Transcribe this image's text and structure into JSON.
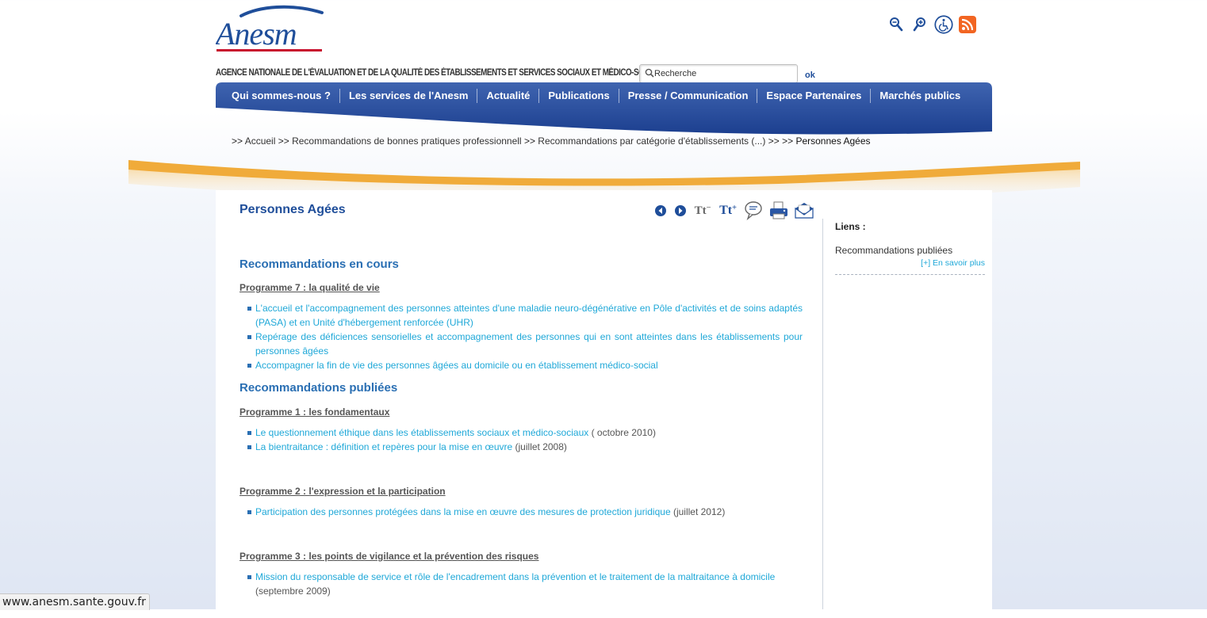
{
  "header": {
    "logo_text": "Anesm",
    "agency_name": "AGENCE NATIONALE DE L'ÉVALUATION ET DE LA QUALITÉ DES ÉTABLISSEMENTS ET SERVICES SOCIAUX ET MÉDICO-SOCIAUX",
    "search": {
      "value": "Recherche",
      "button": "ok"
    },
    "tools": [
      "zoom-out-icon",
      "zoom-in-icon",
      "accessibility-icon",
      "rss-icon"
    ]
  },
  "nav": {
    "items": [
      "Qui sommes-nous ?",
      "Les services de l'Anesm",
      "Actualité",
      "Publications",
      "Presse / Communication",
      "Espace Partenaires",
      "Marchés publics"
    ]
  },
  "breadcrumb": {
    "sep": ">>",
    "items": [
      "Accueil",
      "Recommandations de bonnes pratiques professionnell",
      "Recommandations par catégorie d'établissements (...)",
      ">>",
      "Personnes Agées"
    ]
  },
  "page": {
    "title": "Personnes Agées",
    "tools": [
      "previous-icon",
      "next-icon",
      "decrease-text-icon",
      "increase-text-icon",
      "comment-icon",
      "print-icon",
      "email-icon"
    ],
    "decrease_label": "Tt",
    "increase_label": "Tt",
    "sections": [
      {
        "title": "Recommandations en cours",
        "programmes": [
          {
            "title": "Programme 7 : la qualité de vie",
            "items": [
              {
                "link": "L'accueil et l'accompagnement des personnes atteintes d'une maladie neuro-dégénérative en Pôle d'activités et de soins adaptés (PASA) et en Unité d'hébergement renforcée (UHR)",
                "date": ""
              },
              {
                "link": "Repérage des déficiences sensorielles et accompagnement des personnes qui en sont atteintes dans les établissements pour personnes âgées",
                "date": ""
              },
              {
                "link": "Accompagner la fin de vie des personnes âgées au domicile ou en établissement médico-social",
                "date": ""
              }
            ]
          }
        ]
      },
      {
        "title": "Recommandations publiées",
        "programmes": [
          {
            "title": "Programme 1 : les fondamentaux",
            "items": [
              {
                "link": "Le questionnement éthique dans les établissements sociaux et médico-sociaux",
                "date": " ( octobre 2010)"
              },
              {
                "link": "La bientraitance : définition et repères pour la mise en œuvre",
                "date": " (juillet 2008)"
              }
            ]
          },
          {
            "title": "Programme 2 : l'expression et la participation",
            "items": [
              {
                "link": "Participation des personnes protégées dans la mise en œuvre des mesures de protection juridique",
                "date": " (juillet 2012)"
              }
            ]
          },
          {
            "title": "Programme 3 : les points de vigilance et la prévention des risques",
            "items": [
              {
                "link": "Mission du responsable de service et rôle de l'encadrement dans la prévention et le traitement de la maltraitance à domicile",
                "date": "(septembre 2009)"
              }
            ]
          }
        ]
      }
    ]
  },
  "sidebar": {
    "title": "Liens :",
    "item": "Recommandations publiées",
    "more": "[+] En savoir plus"
  },
  "status_bar": {
    "url": "www.anesm.sante.gouv.fr"
  },
  "colors": {
    "brand_blue": "#1f4e9a",
    "link": "#1fa8d8",
    "orange": "#f0ab3a",
    "rss": "#f26522"
  }
}
